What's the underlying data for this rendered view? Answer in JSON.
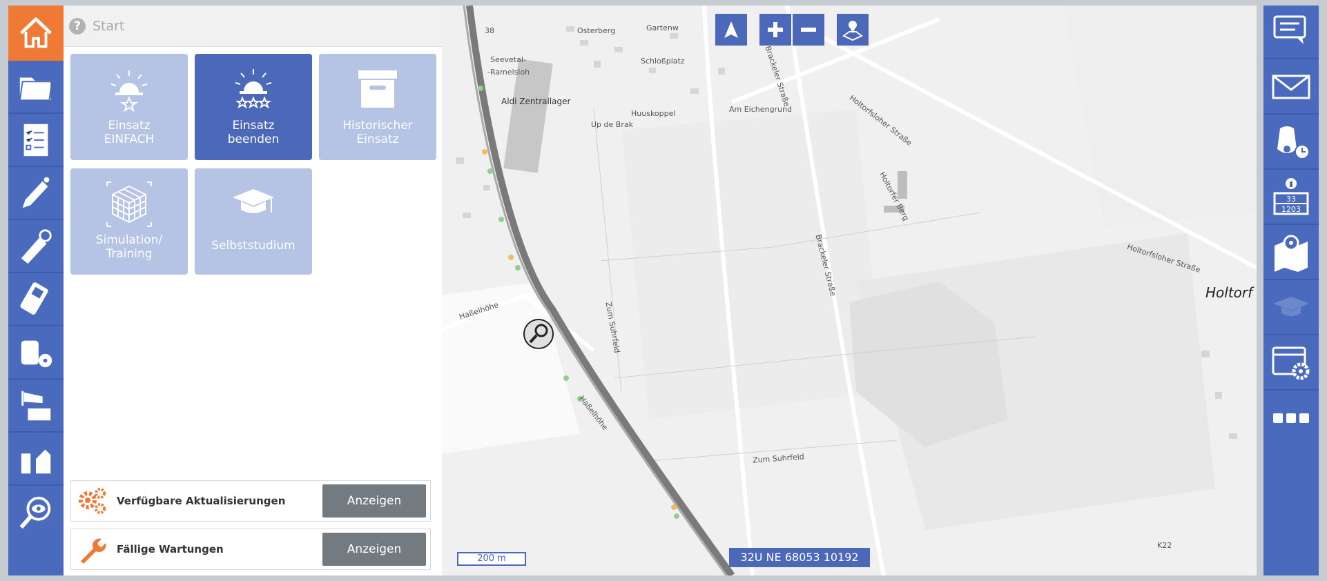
{
  "panel": {
    "title": "Start",
    "help": "?"
  },
  "tiles": [
    {
      "label": "Einsatz\nEINFACH",
      "active": false
    },
    {
      "label": "Einsatz\nbeenden",
      "active": true
    },
    {
      "label": "Historischer\nEinsatz",
      "active": false
    },
    {
      "label": "Simulation/\nTraining",
      "active": false
    },
    {
      "label": "Selbststudium",
      "active": false
    }
  ],
  "updates": {
    "label": "Verfügbare Aktualisierungen",
    "button": "Anzeigen"
  },
  "maintenance": {
    "label": "Fällige Wartungen",
    "button": "Anzeigen"
  },
  "map": {
    "scale": "200 m",
    "coordinates": "32U NE 68053 10192",
    "labels": {
      "seevetal": "Seevetal-",
      "ramelsloh": "-Ramelsloh",
      "aldi": "Aldi Zentrallager",
      "osterberg": "Osterberg",
      "gartenw": "Gartenw",
      "schlossplatz": "Schloßplatz",
      "huuskoppel": "Huuskoppel",
      "upde": "Up de Brak",
      "eichengrund": "Am Eichengrund",
      "holtorfsloher": "Holtorfsloher Straße",
      "holtorfsloher2": "Holtorfsloher Straße",
      "brackeler": "Brackeler Straße",
      "brackeler2": "Brackeler Straße",
      "holtorfer_berg": "Holtorfer Berg",
      "zum_suhrfeld": "Zum Suhrfeld",
      "zum_suhrfeld2": "Zum Suhrfeld",
      "hassel": "Haßelhöhe",
      "hassel2": "Haßelhöhe",
      "holtorf": "Holtorf",
      "k22": "K22",
      "a38": "38"
    }
  },
  "colors": {
    "accent": "#4b69b8",
    "home": "#ef7a35",
    "tile_inactive": "#b5c3e4"
  }
}
